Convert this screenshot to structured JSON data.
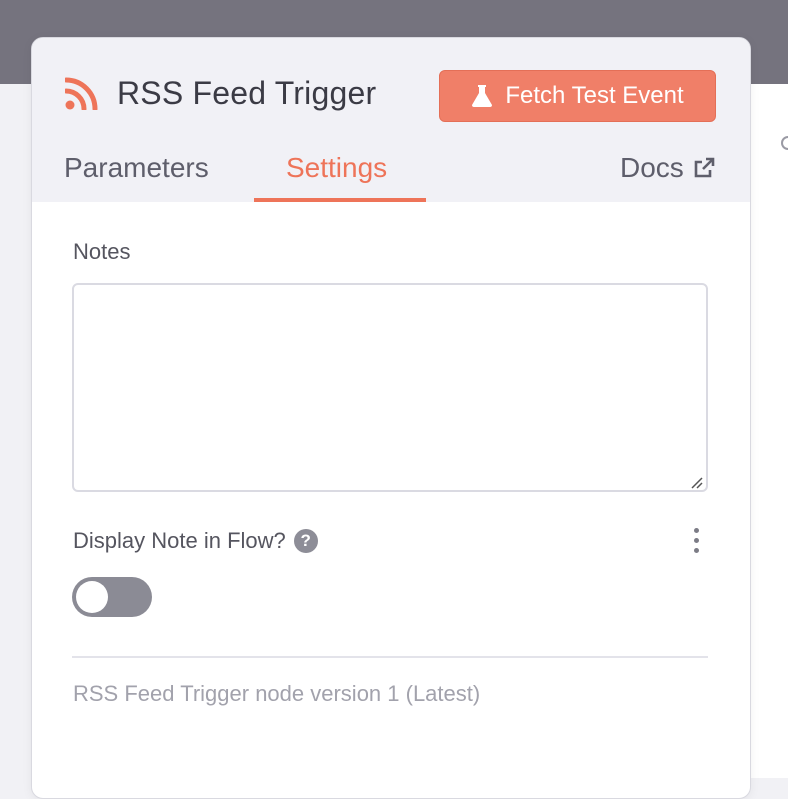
{
  "node": {
    "title": "RSS Feed Trigger",
    "icon": "rss-icon",
    "accent_color": "#ee7459"
  },
  "header": {
    "fetch_button_label": "Fetch Test Event",
    "fetch_button_icon": "flask-icon"
  },
  "tabs": [
    {
      "label": "Parameters",
      "active": false
    },
    {
      "label": "Settings",
      "active": true
    },
    {
      "label": "Docs",
      "active": false,
      "icon": "external-link-icon"
    }
  ],
  "settings": {
    "notes_label": "Notes",
    "notes_value": "",
    "display_note_label": "Display Note in Flow?",
    "display_note_enabled": false,
    "version_text": "RSS Feed Trigger node version 1 (Latest)"
  }
}
